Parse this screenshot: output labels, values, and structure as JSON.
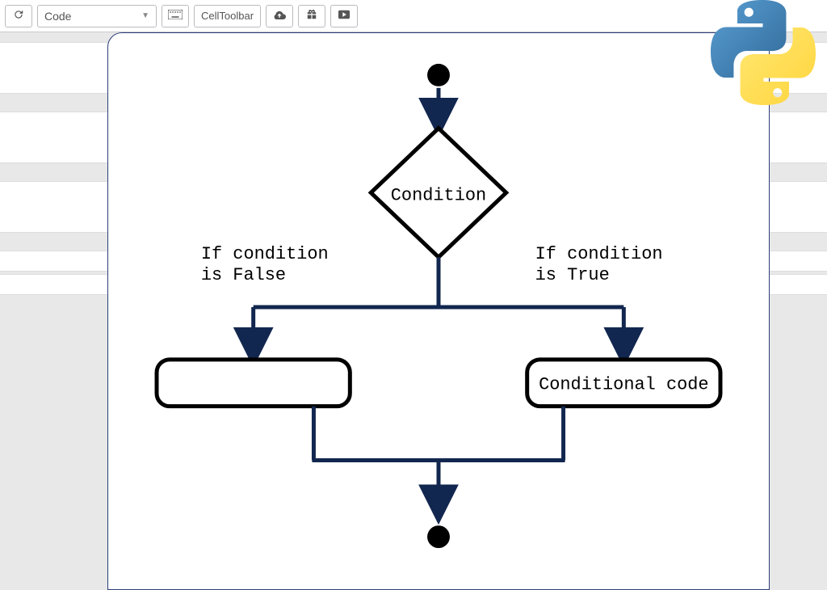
{
  "toolbar": {
    "restart_title": "Restart",
    "cell_type_selected": "Code",
    "keyboard_title": "Keyboard",
    "celltoolbar_label": "CellToolbar",
    "upload_title": "Upload",
    "gift_title": "Gift",
    "present_title": "Present"
  },
  "logo": {
    "name": "python-logo"
  },
  "diagram": {
    "condition_label": "Condition",
    "false_label_line1": "If condition",
    "false_label_line2": "is False",
    "true_label_line1": "If condition",
    "true_label_line2": "is True",
    "false_box_label": "",
    "true_box_label": "Conditional code"
  }
}
